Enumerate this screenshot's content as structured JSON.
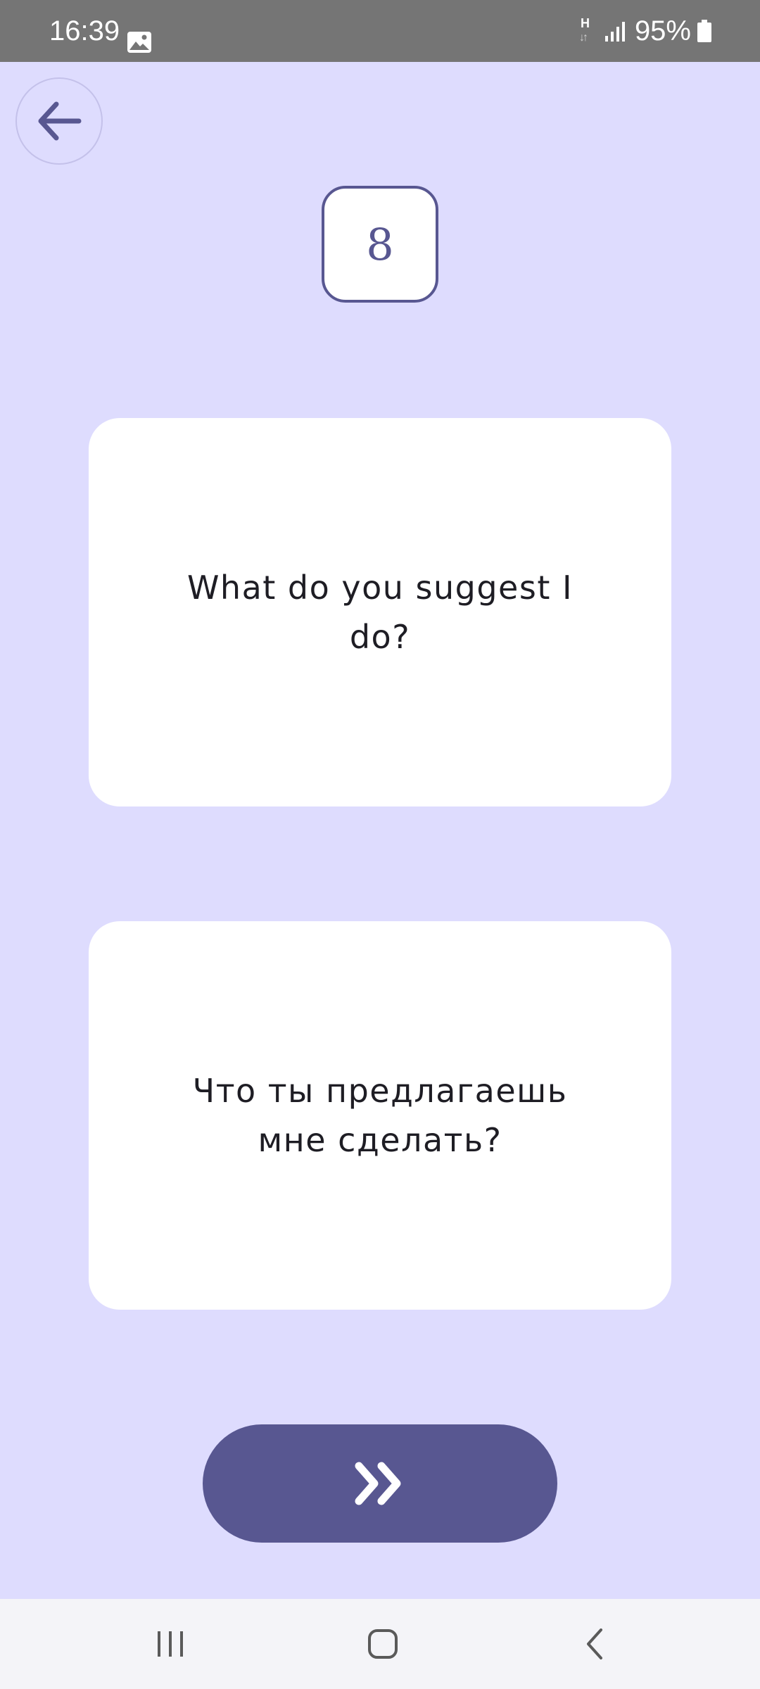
{
  "status_bar": {
    "time": "16:39",
    "network_type": "H",
    "battery_percent": "95%",
    "icons": [
      "gallery-icon",
      "network-h-icon",
      "signal-icon",
      "battery-icon"
    ]
  },
  "toolbar": {
    "back_icon": "arrow-left-icon"
  },
  "counter": {
    "value": "8"
  },
  "cards": {
    "english": "What do you suggest I do?",
    "russian": "Что ты предлагаешь мне сделать?"
  },
  "next_button": {
    "icon": "double-chevron-right-icon"
  },
  "nav_bar": {
    "icons": [
      "recent-apps-icon",
      "home-icon",
      "back-icon"
    ]
  },
  "colors": {
    "background": "#dedcfe",
    "accent": "#585791",
    "card": "#ffffff",
    "status_bar": "#757575",
    "nav_bar": "#f4f4f8"
  }
}
